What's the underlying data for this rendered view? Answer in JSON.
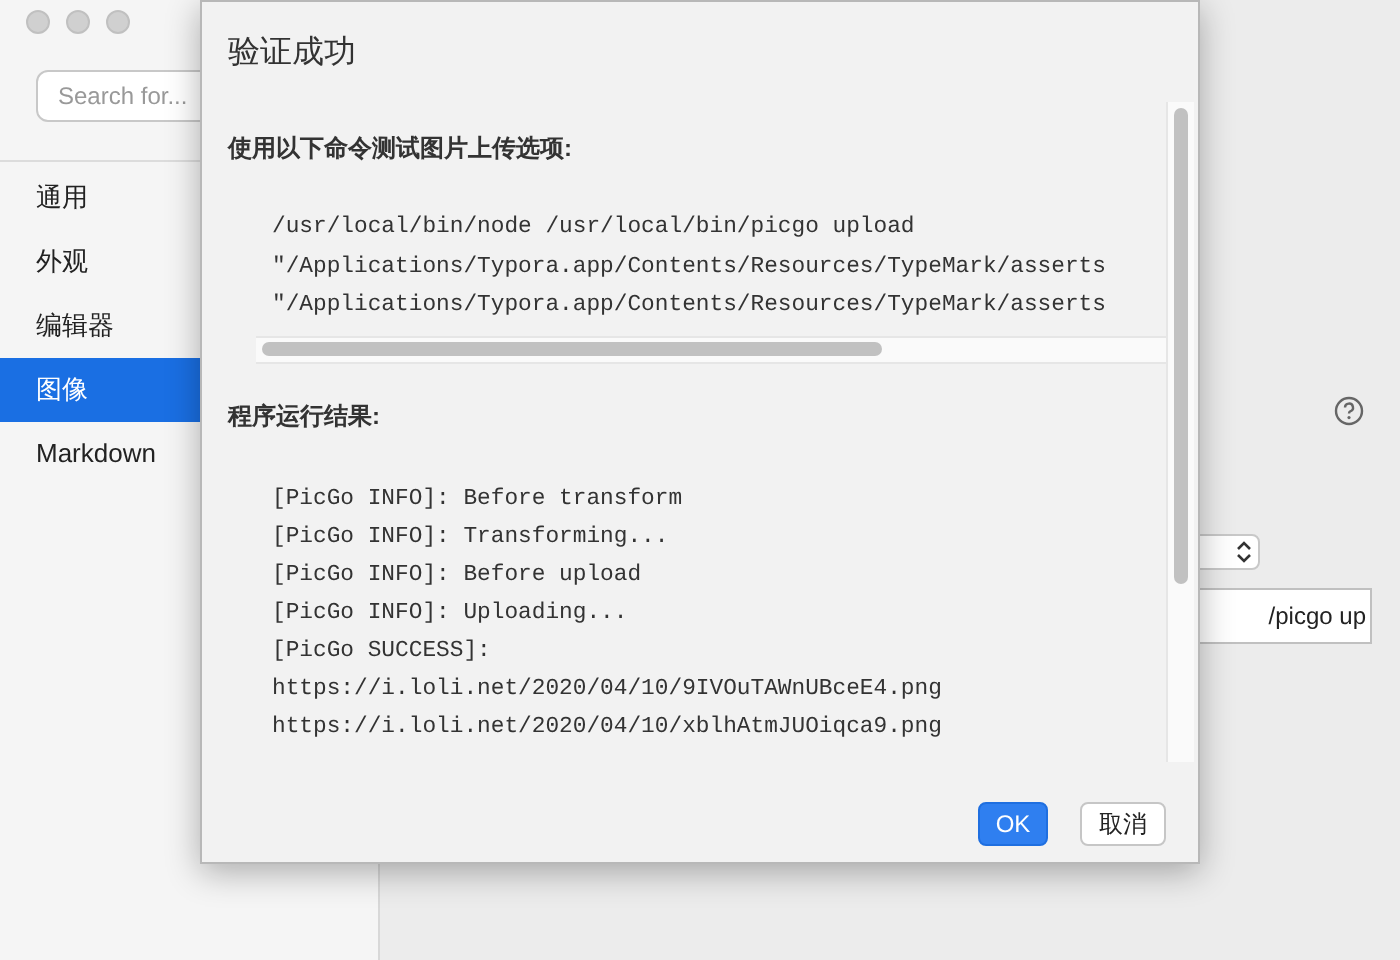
{
  "sidebar": {
    "search": {
      "placeholder": "Search for..."
    },
    "items": [
      {
        "label": "通用",
        "selected": false
      },
      {
        "label": "外观",
        "selected": false
      },
      {
        "label": "编辑器",
        "selected": false
      },
      {
        "label": "图像",
        "selected": true
      },
      {
        "label": "Markdown",
        "selected": false
      }
    ]
  },
  "settings": {
    "command_field": {
      "value": "/picgo up"
    }
  },
  "dialog": {
    "title": "验证成功",
    "command_label": "使用以下命令测试图片上传选项:",
    "command_lines": [
      "/usr/local/bin/node /usr/local/bin/picgo upload",
      "\"/Applications/Typora.app/Contents/Resources/TypeMark/asserts",
      "\"/Applications/Typora.app/Contents/Resources/TypeMark/asserts"
    ],
    "result_label": "程序运行结果:",
    "result_lines": [
      "[PicGo INFO]: Before transform",
      "[PicGo INFO]: Transforming...",
      "[PicGo INFO]: Before upload",
      "[PicGo INFO]: Uploading...",
      "[PicGo SUCCESS]:",
      "https://i.loli.net/2020/04/10/9IVOuTAWnUBceE4.png",
      "https://i.loli.net/2020/04/10/xblhAtmJUOiqca9.png"
    ],
    "buttons": [
      {
        "label": "OK",
        "kind": "primary"
      },
      {
        "label": "取消",
        "kind": "secondary"
      }
    ]
  }
}
